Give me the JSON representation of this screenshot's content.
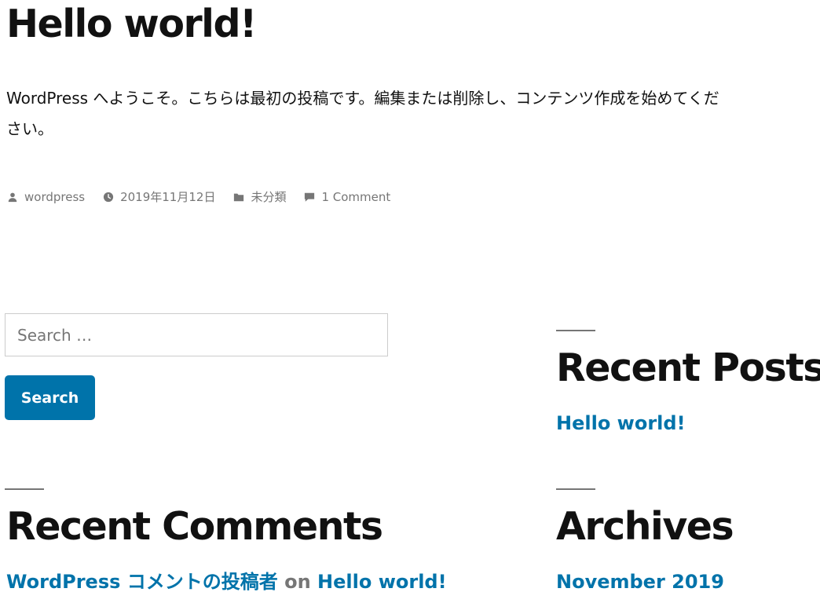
{
  "post": {
    "title": "Hello world!",
    "content": "WordPress へようこそ。こちらは最初の投稿です。編集または削除し、コンテンツ作成を始めてください。",
    "meta": {
      "author": "wordpress",
      "date": "2019年11月12日",
      "category": "未分類",
      "comments": "1 Comment"
    }
  },
  "search": {
    "placeholder": "Search …",
    "value": "",
    "button_label": "Search"
  },
  "widgets": {
    "recent_posts": {
      "title": "Recent Posts",
      "items": [
        "Hello world!"
      ]
    },
    "recent_comments": {
      "title": "Recent Comments",
      "items": [
        {
          "author": "WordPress コメントの投稿者",
          "on": "on",
          "post": "Hello world!"
        }
      ]
    },
    "archives": {
      "title": "Archives",
      "items": [
        "November 2019"
      ]
    }
  },
  "icons": {
    "author": "person-icon",
    "date": "clock-icon",
    "category": "folder-icon",
    "comments": "comment-icon"
  },
  "colors": {
    "link": "#0073aa",
    "meta": "#767676",
    "text": "#111111",
    "button_bg": "#0073aa"
  }
}
